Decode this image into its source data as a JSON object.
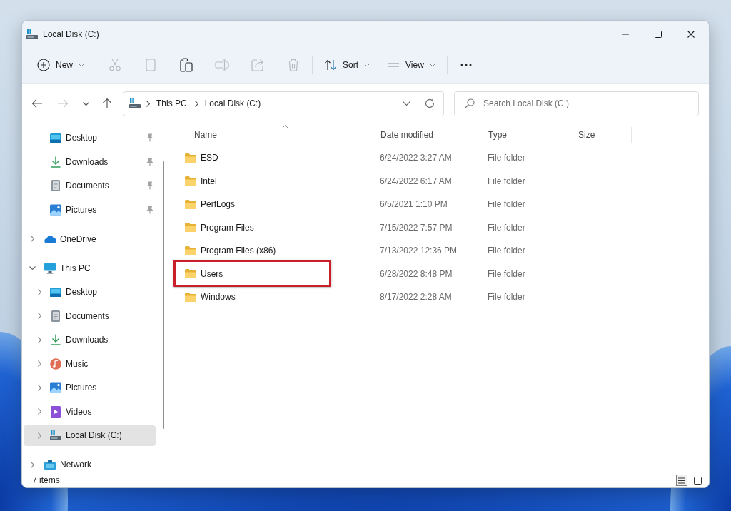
{
  "window": {
    "title": "Local Disk (C:)"
  },
  "toolbar": [
    {
      "kind": "menu",
      "label": "New",
      "disabled": false
    },
    {
      "kind": "action",
      "disabled": true
    },
    {
      "kind": "action",
      "disabled": true
    },
    {
      "kind": "action",
      "disabled": false
    },
    {
      "kind": "action",
      "disabled": true
    },
    {
      "kind": "action",
      "disabled": true
    },
    {
      "kind": "action",
      "disabled": true
    },
    {
      "kind": "menu",
      "label": "Sort",
      "disabled": false
    },
    {
      "kind": "menu",
      "label": "View",
      "disabled": false
    },
    {
      "kind": "more",
      "disabled": false
    }
  ],
  "navigation": [
    {
      "disabled": false
    },
    {
      "disabled": true
    },
    {
      "disabled": false
    },
    {
      "disabled": false
    }
  ],
  "address_bar": {
    "breadcrumbs": [
      "This PC",
      "Local Disk (C:)"
    ]
  },
  "search": {
    "placeholder": "Search Local Disk (C:)"
  },
  "sidebar": {
    "quick_access": [
      {
        "kind": "desktop",
        "label": "Desktop",
        "pinned": true,
        "selected": false
      },
      {
        "kind": "downloads",
        "label": "Downloads",
        "pinned": true,
        "selected": false
      },
      {
        "kind": "documents",
        "label": "Documents",
        "pinned": true,
        "selected": false
      },
      {
        "kind": "pictures",
        "label": "Pictures",
        "pinned": true,
        "selected": false
      }
    ],
    "tree": [
      {
        "kind": "cloud",
        "label": "OneDrive",
        "expanded": false,
        "selected": false
      },
      {
        "kind": "computer",
        "label": "This PC",
        "expanded": true,
        "selected": false,
        "children": [
          {
            "kind": "desktop",
            "label": "Desktop",
            "expanded": false,
            "selected": false
          },
          {
            "kind": "documents",
            "label": "Documents",
            "expanded": false,
            "selected": false
          },
          {
            "kind": "downloads",
            "label": "Downloads",
            "expanded": false,
            "selected": false
          },
          {
            "kind": "music",
            "label": "Music",
            "expanded": false,
            "selected": false
          },
          {
            "kind": "pictures",
            "label": "Pictures",
            "expanded": false,
            "selected": false
          },
          {
            "kind": "videos",
            "label": "Videos",
            "expanded": false,
            "selected": false
          },
          {
            "kind": "drive",
            "label": "Local Disk (C:)",
            "expanded": false,
            "selected": true
          }
        ]
      },
      {
        "kind": "network",
        "label": "Network",
        "expanded": false,
        "selected": false
      }
    ]
  },
  "files": {
    "columns": [
      {
        "label": "Name",
        "sorted": true
      },
      {
        "label": "Date modified",
        "sorted": false
      },
      {
        "label": "Type",
        "sorted": false
      },
      {
        "label": "Size",
        "sorted": false
      }
    ],
    "rows": [
      {
        "name": "ESD",
        "date_modified": "6/24/2022 3:27 AM",
        "type": "File folder",
        "highlighted": false
      },
      {
        "name": "Intel",
        "date_modified": "6/24/2022 6:17 AM",
        "type": "File folder",
        "highlighted": false
      },
      {
        "name": "PerfLogs",
        "date_modified": "6/5/2021 1:10 PM",
        "type": "File folder",
        "highlighted": false
      },
      {
        "name": "Program Files",
        "date_modified": "7/15/2022 7:57 PM",
        "type": "File folder",
        "highlighted": false
      },
      {
        "name": "Program Files (x86)",
        "date_modified": "7/13/2022 12:36 PM",
        "type": "File folder",
        "highlighted": false
      },
      {
        "name": "Users",
        "date_modified": "6/28/2022 8:48 PM",
        "type": "File folder",
        "highlighted": true
      },
      {
        "name": "Windows",
        "date_modified": "8/17/2022 2:28 AM",
        "type": "File folder",
        "highlighted": false
      }
    ]
  },
  "status_bar": {
    "item_count": "7 items",
    "view_buttons": [
      {
        "selected": true
      },
      {
        "selected": false
      }
    ]
  }
}
